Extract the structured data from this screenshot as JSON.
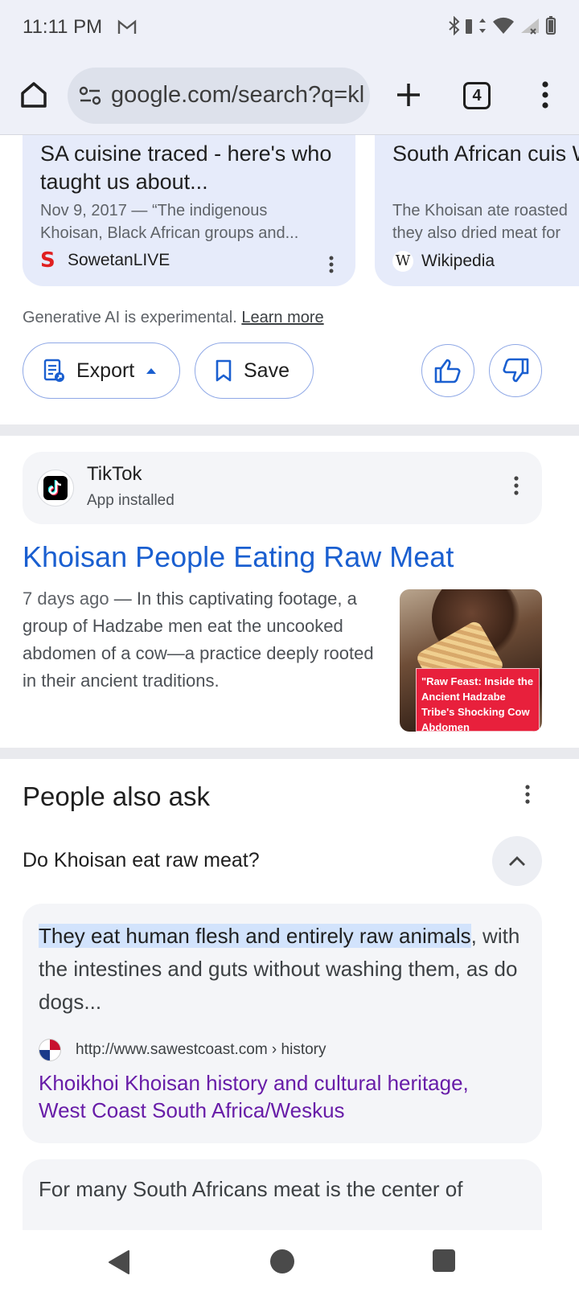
{
  "status_bar": {
    "time": "11:11 PM"
  },
  "browser": {
    "url": "google.com/search?q=kl",
    "tab_count": "4"
  },
  "source_cards": [
    {
      "title": "SA cuisine traced - here's who taught us about...",
      "snippet_line1": "Nov 9, 2017 — “The indigenous",
      "snippet_line2": "Khoisan, Black African groups and...",
      "source": "SowetanLIVE"
    },
    {
      "title": "South African cuis Wikipedia",
      "snippet_line1": "The Khoisan ate roasted",
      "snippet_line2": "they also dried meat for",
      "source": "Wikipedia"
    }
  ],
  "ai_overview": {
    "note": "Generative AI is experimental.",
    "learn_more": "Learn more",
    "export_label": "Export",
    "save_label": "Save"
  },
  "tiktok_result": {
    "app_name": "TikTok",
    "app_status": "App installed",
    "title": "Khoisan People Eating Raw Meat",
    "age": "7 days ago",
    "snippet": " — In this captivating footage, a group of Hadzabe men eat the uncooked abdomen of a cow—a practice deeply rooted in their ancient traditions.",
    "thumb_caption": "\"Raw Feast: Inside the Ancient Hadzabe Tribe's Shocking Cow Abdomen"
  },
  "people_also_ask": {
    "heading": "People also ask",
    "question": "Do Khoisan eat raw meat?",
    "answer_highlight": "They eat human flesh and entirely raw animals",
    "answer_rest": ", with the intestines and guts without washing them, as do dogs...",
    "source_url": "http://www.sawestcoast.com › history",
    "link_text": "Khoikhoi Khoisan history and cultural heritage, West Coast South Africa/Weskus",
    "next_answer_preview": "For many South Africans meat is the center of"
  }
}
